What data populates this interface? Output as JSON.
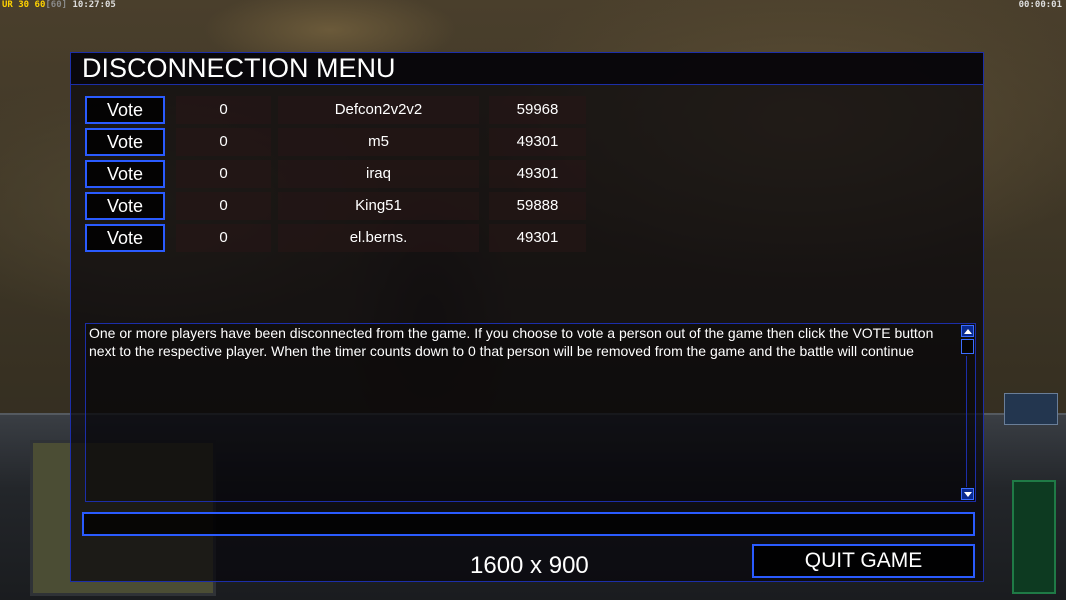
{
  "hud": {
    "top_left_ur": "UR",
    "top_left_n1": "30",
    "top_left_n2": "60",
    "top_left_n3": "[60]",
    "top_left_time": "10:27:05",
    "top_right_timer": "00:00:01"
  },
  "menu": {
    "title": "DISCONNECTION MENU",
    "vote_label": "Vote",
    "players": [
      {
        "votes": "0",
        "name": "Defcon2v2v2",
        "ping": "59968"
      },
      {
        "votes": "0",
        "name": "m5",
        "ping": "49301"
      },
      {
        "votes": "0",
        "name": "iraq",
        "ping": "49301"
      },
      {
        "votes": "0",
        "name": "King51",
        "ping": "59888"
      },
      {
        "votes": "0",
        "name": "el.berns.",
        "ping": "49301"
      }
    ],
    "message": "One or more players have been disconnected from the game. If you choose to vote a person out of the game then click the VOTE button next to the respective player. When the timer counts down to 0 that person will be removed from the game and the battle will continue",
    "chat_value": "",
    "resolution": "1600 x 900",
    "quit_label": "QUIT GAME"
  },
  "colors": {
    "accent_border": "#2a5bff",
    "panel_border": "#1c2ea8",
    "text": "#ffffff"
  }
}
